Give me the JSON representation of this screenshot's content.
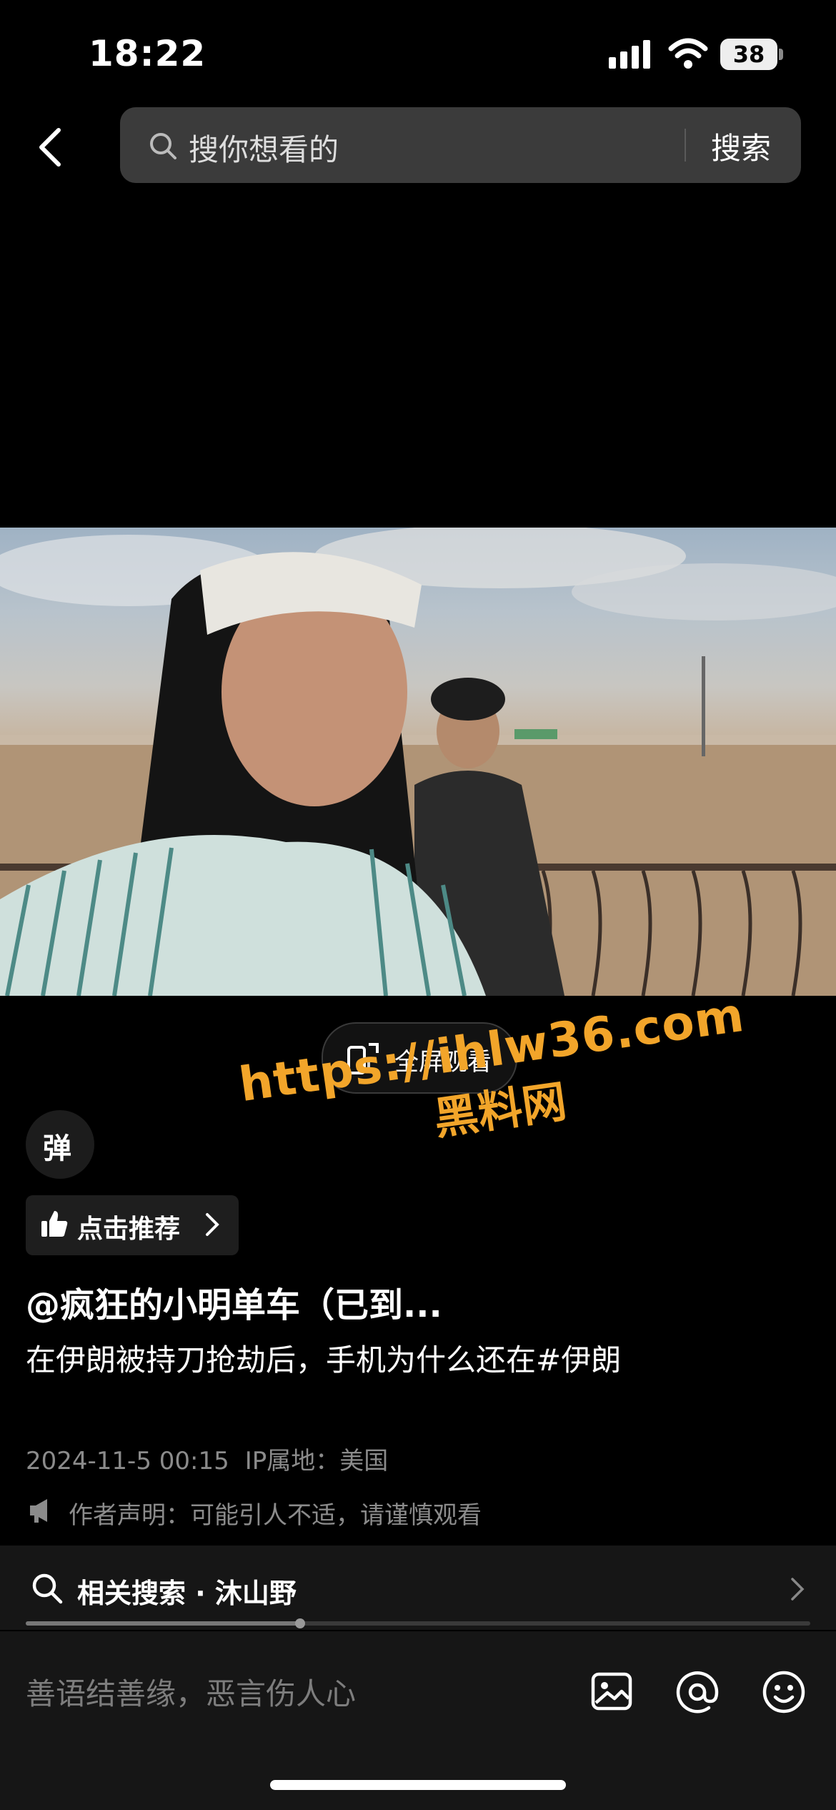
{
  "status_bar": {
    "time": "18:22",
    "battery": "38"
  },
  "search": {
    "placeholder": "搜你想看的",
    "button_label": "搜索"
  },
  "player": {
    "fullscreen_label": "全屏观看",
    "danmu_label": "弹"
  },
  "watermark": {
    "url": "https://ihlw36.com",
    "site": "黑料网"
  },
  "post": {
    "recommend_label": "点击推荐",
    "author": "@疯狂的小明单车（已到...",
    "description": "在伊朗被持刀抢劫后，手机为什么还在#伊朗",
    "date": "2024-11-5 00:15",
    "ip_location": "IP属地：美国",
    "author_notice": "作者声明：可能引人不适，请谨慎观看"
  },
  "related": {
    "text": "相关搜索 · 沐山野",
    "scroll_progress": 0.35
  },
  "comment": {
    "placeholder": "善语结善缘，恶言伤人心"
  },
  "icons": [
    "back-icon",
    "search-icon",
    "fullscreen-rotate-icon",
    "thumbs-up-icon",
    "chevron-right-icon",
    "megaphone-icon",
    "image-icon",
    "at-icon",
    "emoji-icon"
  ]
}
